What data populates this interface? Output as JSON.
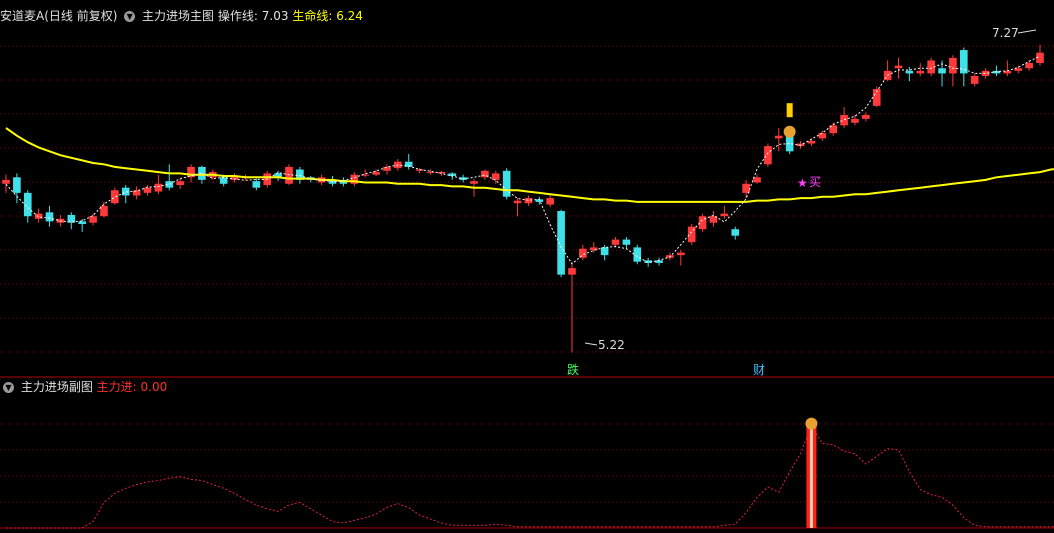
{
  "header": {
    "stock_name": "安道麦A(日线 前复权)",
    "main_indicator": "主力进场主图",
    "op_line_label": "操作线:",
    "op_line_value": "7.03",
    "life_line_label": "生命线:",
    "life_line_value": "6.24"
  },
  "sub_header": {
    "indicator": "主力进场副图",
    "value_label": "主力进:",
    "value": "0.00"
  },
  "annotations": {
    "high": "7.27",
    "low": "5.22",
    "buy": "买",
    "die": "跌",
    "cai": "财"
  },
  "colors": {
    "up": "#ff3a3a",
    "down": "#40e0e8",
    "life_line": "#ffff00",
    "op_line": "#ffffff",
    "sub_line": "#e0204a",
    "grid": "#8b0000",
    "buy_star": "#ff40ff"
  },
  "icons": {
    "dropdown": "chevron-down-icon",
    "money_bag": "money-bag-icon",
    "star": "star-icon"
  },
  "chart_data": {
    "type": "candlestick",
    "candles": [
      {
        "o": 6.55,
        "c": 6.58,
        "h": 6.62,
        "l": 6.48
      },
      {
        "o": 6.6,
        "c": 6.48,
        "h": 6.63,
        "l": 6.4
      },
      {
        "o": 6.48,
        "c": 6.3,
        "h": 6.5,
        "l": 6.25
      },
      {
        "o": 6.28,
        "c": 6.32,
        "h": 6.36,
        "l": 6.25
      },
      {
        "o": 6.33,
        "c": 6.26,
        "h": 6.38,
        "l": 6.22
      },
      {
        "o": 6.25,
        "c": 6.28,
        "h": 6.31,
        "l": 6.22
      },
      {
        "o": 6.31,
        "c": 6.25,
        "h": 6.33,
        "l": 6.2
      },
      {
        "o": 6.26,
        "c": 6.24,
        "h": 6.28,
        "l": 6.18
      },
      {
        "o": 6.25,
        "c": 6.3,
        "h": 6.32,
        "l": 6.23
      },
      {
        "o": 6.3,
        "c": 6.38,
        "h": 6.41,
        "l": 6.29
      },
      {
        "o": 6.4,
        "c": 6.5,
        "h": 6.52,
        "l": 6.39
      },
      {
        "o": 6.52,
        "c": 6.46,
        "h": 6.54,
        "l": 6.4
      },
      {
        "o": 6.46,
        "c": 6.5,
        "h": 6.53,
        "l": 6.43
      },
      {
        "o": 6.48,
        "c": 6.52,
        "h": 6.54,
        "l": 6.46
      },
      {
        "o": 6.49,
        "c": 6.55,
        "h": 6.62,
        "l": 6.47
      },
      {
        "o": 6.57,
        "c": 6.52,
        "h": 6.7,
        "l": 6.5
      },
      {
        "o": 6.54,
        "c": 6.57,
        "h": 6.59,
        "l": 6.51
      },
      {
        "o": 6.6,
        "c": 6.68,
        "h": 6.7,
        "l": 6.56
      },
      {
        "o": 6.68,
        "c": 6.58,
        "h": 6.69,
        "l": 6.55
      },
      {
        "o": 6.6,
        "c": 6.64,
        "h": 6.66,
        "l": 6.58
      },
      {
        "o": 6.6,
        "c": 6.55,
        "h": 6.62,
        "l": 6.53
      },
      {
        "o": 6.58,
        "c": 6.61,
        "h": 6.63,
        "l": 6.56
      },
      {
        "o": 6.6,
        "c": 6.6,
        "h": 6.62,
        "l": 6.58
      },
      {
        "o": 6.57,
        "c": 6.52,
        "h": 6.59,
        "l": 6.5
      },
      {
        "o": 6.54,
        "c": 6.63,
        "h": 6.65,
        "l": 6.52
      },
      {
        "o": 6.63,
        "c": 6.6,
        "h": 6.65,
        "l": 6.57
      },
      {
        "o": 6.55,
        "c": 6.68,
        "h": 6.7,
        "l": 6.54
      },
      {
        "o": 6.66,
        "c": 6.58,
        "h": 6.68,
        "l": 6.55
      },
      {
        "o": 6.6,
        "c": 6.58,
        "h": 6.61,
        "l": 6.56
      },
      {
        "o": 6.56,
        "c": 6.6,
        "h": 6.62,
        "l": 6.54
      },
      {
        "o": 6.58,
        "c": 6.55,
        "h": 6.61,
        "l": 6.53
      },
      {
        "o": 6.58,
        "c": 6.55,
        "h": 6.6,
        "l": 6.53
      },
      {
        "o": 6.55,
        "c": 6.62,
        "h": 6.64,
        "l": 6.53
      },
      {
        "o": 6.62,
        "c": 6.62,
        "h": 6.66,
        "l": 6.6
      },
      {
        "o": 6.62,
        "c": 6.64,
        "h": 6.66,
        "l": 6.61
      },
      {
        "o": 6.65,
        "c": 6.68,
        "h": 6.7,
        "l": 6.62
      },
      {
        "o": 6.67,
        "c": 6.72,
        "h": 6.74,
        "l": 6.65
      },
      {
        "o": 6.72,
        "c": 6.68,
        "h": 6.78,
        "l": 6.66
      },
      {
        "o": 6.65,
        "c": 6.66,
        "h": 6.67,
        "l": 6.63
      },
      {
        "o": 6.64,
        "c": 6.64,
        "h": 6.66,
        "l": 6.62
      },
      {
        "o": 6.63,
        "c": 6.64,
        "h": 6.65,
        "l": 6.61
      },
      {
        "o": 6.63,
        "c": 6.61,
        "h": 6.64,
        "l": 6.58
      },
      {
        "o": 6.6,
        "c": 6.58,
        "h": 6.62,
        "l": 6.56
      },
      {
        "o": 6.55,
        "c": 6.57,
        "h": 6.59,
        "l": 6.45
      },
      {
        "o": 6.6,
        "c": 6.65,
        "h": 6.66,
        "l": 6.58
      },
      {
        "o": 6.58,
        "c": 6.63,
        "h": 6.65,
        "l": 6.55
      },
      {
        "o": 6.65,
        "c": 6.45,
        "h": 6.67,
        "l": 6.43
      },
      {
        "o": 6.4,
        "c": 6.42,
        "h": 6.44,
        "l": 6.3
      },
      {
        "o": 6.4,
        "c": 6.44,
        "h": 6.46,
        "l": 6.38
      },
      {
        "o": 6.43,
        "c": 6.41,
        "h": 6.45,
        "l": 6.39
      },
      {
        "o": 6.39,
        "c": 6.44,
        "h": 6.46,
        "l": 6.37
      },
      {
        "o": 6.34,
        "c": 5.85,
        "h": 6.35,
        "l": 5.83
      },
      {
        "o": 5.85,
        "c": 5.9,
        "h": 5.95,
        "l": 5.25
      },
      {
        "o": 5.98,
        "c": 6.05,
        "h": 6.08,
        "l": 5.96
      },
      {
        "o": 6.04,
        "c": 6.06,
        "h": 6.1,
        "l": 6.02
      },
      {
        "o": 6.06,
        "c": 6.0,
        "h": 6.08,
        "l": 5.96
      },
      {
        "o": 6.08,
        "c": 6.12,
        "h": 6.14,
        "l": 6.06
      },
      {
        "o": 6.12,
        "c": 6.08,
        "h": 6.14,
        "l": 6.05
      },
      {
        "o": 6.06,
        "c": 5.95,
        "h": 6.08,
        "l": 5.93
      },
      {
        "o": 5.96,
        "c": 5.94,
        "h": 5.98,
        "l": 5.91
      },
      {
        "o": 5.96,
        "c": 5.94,
        "h": 5.98,
        "l": 5.92
      },
      {
        "o": 5.98,
        "c": 6.0,
        "h": 6.02,
        "l": 5.96
      },
      {
        "o": 6.0,
        "c": 6.02,
        "h": 6.04,
        "l": 5.92
      },
      {
        "o": 6.1,
        "c": 6.22,
        "h": 6.24,
        "l": 6.08
      },
      {
        "o": 6.2,
        "c": 6.3,
        "h": 6.32,
        "l": 6.18
      },
      {
        "o": 6.25,
        "c": 6.3,
        "h": 6.34,
        "l": 6.22
      },
      {
        "o": 6.3,
        "c": 6.32,
        "h": 6.38,
        "l": 6.28
      },
      {
        "o": 6.2,
        "c": 6.15,
        "h": 6.22,
        "l": 6.12
      },
      {
        "o": 6.48,
        "c": 6.55,
        "h": 6.58,
        "l": 6.44
      },
      {
        "o": 6.56,
        "c": 6.6,
        "h": 6.62,
        "l": 6.55
      },
      {
        "o": 6.7,
        "c": 6.84,
        "h": 6.86,
        "l": 6.68
      },
      {
        "o": 6.9,
        "c": 6.92,
        "h": 6.98,
        "l": 6.8
      },
      {
        "o": 6.92,
        "c": 6.8,
        "h": 6.93,
        "l": 6.78
      },
      {
        "o": 6.84,
        "c": 6.86,
        "h": 6.88,
        "l": 6.82
      },
      {
        "o": 6.86,
        "c": 6.88,
        "h": 6.9,
        "l": 6.84
      },
      {
        "o": 6.9,
        "c": 6.94,
        "h": 6.96,
        "l": 6.88
      },
      {
        "o": 6.94,
        "c": 7.0,
        "h": 7.02,
        "l": 6.92
      },
      {
        "o": 7.0,
        "c": 7.08,
        "h": 7.14,
        "l": 6.98
      },
      {
        "o": 7.02,
        "c": 7.05,
        "h": 7.08,
        "l": 7.0
      },
      {
        "o": 7.05,
        "c": 7.08,
        "h": 7.1,
        "l": 7.03
      },
      {
        "o": 7.15,
        "c": 7.28,
        "h": 7.3,
        "l": 7.14
      },
      {
        "o": 7.35,
        "c": 7.42,
        "h": 7.5,
        "l": 7.34
      },
      {
        "o": 7.44,
        "c": 7.46,
        "h": 7.52,
        "l": 7.36
      },
      {
        "o": 7.42,
        "c": 7.4,
        "h": 7.45,
        "l": 7.34
      },
      {
        "o": 7.4,
        "c": 7.42,
        "h": 7.48,
        "l": 7.38
      },
      {
        "o": 7.4,
        "c": 7.5,
        "h": 7.52,
        "l": 7.38
      },
      {
        "o": 7.44,
        "c": 7.4,
        "h": 7.5,
        "l": 7.3
      },
      {
        "o": 7.4,
        "c": 7.52,
        "h": 7.54,
        "l": 7.3
      },
      {
        "o": 7.58,
        "c": 7.4,
        "h": 7.6,
        "l": 7.3
      },
      {
        "o": 7.32,
        "c": 7.38,
        "h": 7.4,
        "l": 7.3
      },
      {
        "o": 7.38,
        "c": 7.42,
        "h": 7.44,
        "l": 7.36
      },
      {
        "o": 7.42,
        "c": 7.4,
        "h": 7.46,
        "l": 7.38
      },
      {
        "o": 7.4,
        "c": 7.42,
        "h": 7.5,
        "l": 7.38
      },
      {
        "o": 7.42,
        "c": 7.44,
        "h": 7.46,
        "l": 7.4
      },
      {
        "o": 7.44,
        "c": 7.48,
        "h": 7.5,
        "l": 7.42
      },
      {
        "o": 7.48,
        "c": 7.56,
        "h": 7.62,
        "l": 7.46
      }
    ],
    "life_line": [
      6.98,
      6.92,
      6.87,
      6.83,
      6.8,
      6.77,
      6.75,
      6.73,
      6.71,
      6.7,
      6.68,
      6.67,
      6.66,
      6.65,
      6.64,
      6.63,
      6.63,
      6.62,
      6.62,
      6.62,
      6.61,
      6.61,
      6.6,
      6.6,
      6.6,
      6.6,
      6.59,
      6.59,
      6.59,
      6.58,
      6.58,
      6.57,
      6.57,
      6.56,
      6.56,
      6.56,
      6.55,
      6.55,
      6.55,
      6.54,
      6.54,
      6.53,
      6.53,
      6.52,
      6.52,
      6.51,
      6.5,
      6.5,
      6.49,
      6.48,
      6.47,
      6.46,
      6.45,
      6.44,
      6.43,
      6.43,
      6.42,
      6.42,
      6.41,
      6.41,
      6.41,
      6.41,
      6.41,
      6.41,
      6.41,
      6.41,
      6.41,
      6.41,
      6.41,
      6.42,
      6.42,
      6.43,
      6.43,
      6.44,
      6.44,
      6.45,
      6.45,
      6.46,
      6.47,
      6.47,
      6.48,
      6.49,
      6.5,
      6.51,
      6.52,
      6.53,
      6.54,
      6.55,
      6.56,
      6.57,
      6.58,
      6.6,
      6.61,
      6.62,
      6.63,
      6.64,
      6.66,
      6.67,
      6.69,
      6.7
    ],
    "sub_series": [
      0,
      0,
      0,
      0,
      0,
      0,
      0,
      0,
      0.05,
      0.2,
      0.27,
      0.31,
      0.34,
      0.36,
      0.37,
      0.39,
      0.4,
      0.38,
      0.37,
      0.34,
      0.31,
      0.27,
      0.22,
      0.18,
      0.15,
      0.13,
      0.18,
      0.2,
      0.15,
      0.1,
      0.05,
      0.04,
      0.06,
      0.08,
      0.11,
      0.16,
      0.19,
      0.16,
      0.1,
      0.07,
      0.04,
      0.02,
      0.02,
      0.02,
      0.02,
      0.03,
      0.02,
      0.01,
      0.01,
      0.01,
      0.01,
      0.01,
      0.01,
      0.01,
      0.01,
      0.01,
      0.01,
      0.01,
      0.01,
      0.01,
      0.01,
      0.01,
      0.01,
      0.01,
      0.01,
      0.01,
      0.02,
      0.03,
      0.12,
      0.24,
      0.32,
      0.28,
      0.44,
      0.58,
      0.8,
      0.66,
      0.65,
      0.6,
      0.58,
      0.5,
      0.56,
      0.62,
      0.61,
      0.44,
      0.3,
      0.26,
      0.24,
      0.18,
      0.08,
      0.02,
      0.01,
      0.01,
      0.01,
      0.01,
      0.01,
      0.01,
      0.01,
      0.01,
      0.01,
      0.01
    ],
    "sub_signal_index": 74,
    "price_range": [
      5.1,
      7.75
    ],
    "sub_range": [
      0,
      1.0
    ],
    "grid": true,
    "legend": "none"
  }
}
